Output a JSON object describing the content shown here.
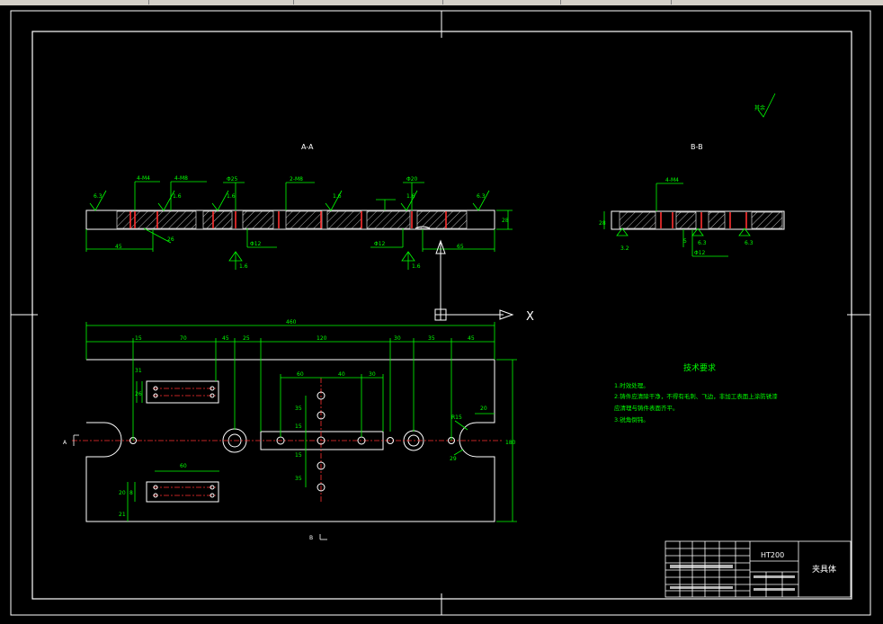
{
  "drawing": {
    "title_block": {
      "material": "HT200",
      "part_name": "夹具体"
    },
    "section_labels": {
      "aa": "A-A",
      "bb": "B-B",
      "a": "A",
      "b": "B"
    },
    "roughness_note": "其余",
    "tech_requirements": {
      "title": "技术要求",
      "lines": [
        "1.时效处理。",
        "2.铸件应清除干净，不得有毛刺、飞边，非加工表面上涂防锈漆",
        "应清理与铸件表面齐平。",
        "3.锐角倒钝。"
      ]
    },
    "dims": {
      "overall_length": "460",
      "top_chain": [
        "15",
        "70",
        "45",
        "25",
        "120",
        "30",
        "35",
        "45"
      ],
      "inner_chain": [
        "60",
        "40",
        "30"
      ],
      "slot_len": "60",
      "vert_holes": [
        "35",
        "15",
        "15",
        "35"
      ],
      "right_r": "R15",
      "right_20": "20",
      "height_right": "180",
      "left_v": [
        "31",
        "26",
        "20",
        "21",
        "8"
      ],
      "d29": "29",
      "phi12": "Φ12",
      "aa_labels": [
        "4-M4",
        "4-M8",
        "Φ25",
        "2-M8",
        "Φ20",
        "45",
        "65",
        "26",
        "28"
      ],
      "bb_labels": [
        "4-M4",
        "28",
        "5"
      ],
      "roughness": [
        "6.3",
        "1.6",
        "1.6",
        "1.6",
        "1.6",
        "1.6",
        "6.3",
        "1.6",
        "1.6",
        "6.3",
        "6.3",
        "3.2",
        "6.3"
      ]
    },
    "ucs": {
      "x": "X"
    }
  }
}
